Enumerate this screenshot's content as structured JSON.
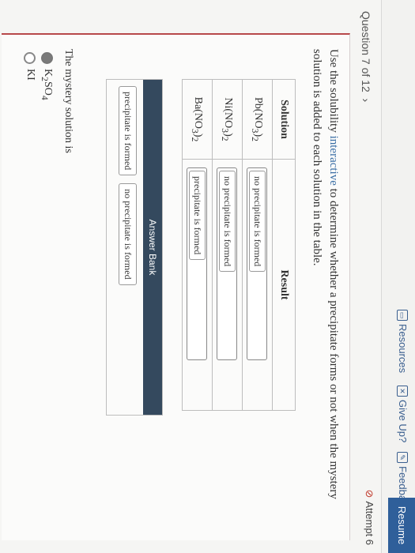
{
  "topbar": {
    "resources": "Resources",
    "give_up": "Give Up?",
    "feedback": "Feedback",
    "resume": "Resume"
  },
  "question": {
    "counter": "Question 7 of 12",
    "attempt": "Attempt 6",
    "instruction_pre": "Use the solubility ",
    "instruction_link": "interactive",
    "instruction_post": " to determine whether a precipitate forms or not when the mystery solution is added to each solution in the table."
  },
  "table": {
    "col_solution": "Solution",
    "col_result": "Result",
    "rows": [
      {
        "solution_main": "Pb(NO",
        "sub1": "3",
        "close": ")",
        "sub2": "2",
        "result": "no precipitate is formed"
      },
      {
        "solution_main": "Ni(NO",
        "sub1": "3",
        "close": ")",
        "sub2": "2",
        "result": "no precipitate is formed"
      },
      {
        "solution_main": "Ba(NO",
        "sub1": "3",
        "close": ")",
        "sub2": "2",
        "result": "precipitate is formed"
      }
    ]
  },
  "answer_bank": {
    "title": "Answer Bank",
    "chips": [
      "precipitate is formed",
      "no precipitate is formed"
    ]
  },
  "mystery": {
    "prompt": "The mystery solution is",
    "options": [
      {
        "label_main": "K",
        "sub": "2",
        "label_mid": "SO",
        "sub2": "4",
        "selected": true
      },
      {
        "label_main": "KI",
        "sub": "",
        "label_mid": "",
        "sub2": "",
        "selected": false
      }
    ]
  },
  "colors": {
    "accent": "#2f5f9a",
    "card_border": "#b7484a",
    "bank_header": "#34495e"
  }
}
